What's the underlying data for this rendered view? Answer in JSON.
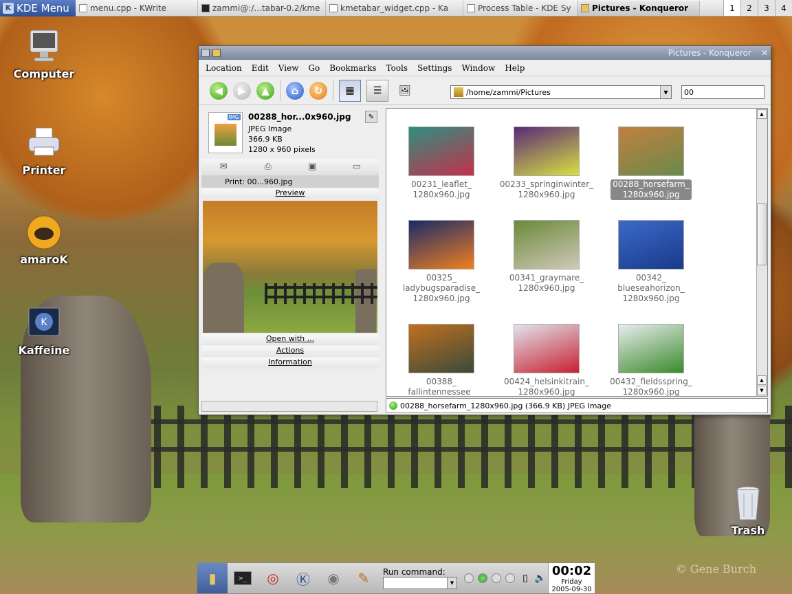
{
  "taskbar": {
    "kmenu_label": "KDE Menu",
    "tasks": [
      {
        "label": "menu.cpp - KWrite",
        "active": false
      },
      {
        "label": "zammi@:/...tabar-0.2/kme",
        "active": false
      },
      {
        "label": "kmetabar_widget.cpp - Ka",
        "active": false
      },
      {
        "label": "Process Table - KDE Sy",
        "active": false
      },
      {
        "label": "Pictures - Konqueror",
        "active": true
      }
    ],
    "desktops": [
      "1",
      "2",
      "3",
      "4"
    ],
    "current_desktop": "1"
  },
  "desktop": {
    "icons": [
      {
        "label": "Computer",
        "icon": "computer-icon"
      },
      {
        "label": "Printer",
        "icon": "printer-icon"
      },
      {
        "label": "amaroK",
        "icon": "amarok-icon"
      },
      {
        "label": "Kaffeine",
        "icon": "kaffeine-icon"
      },
      {
        "label": "Trash",
        "icon": "trash-icon"
      }
    ],
    "watermark": "© Gene Burch"
  },
  "window": {
    "title": "Pictures - Konqueror",
    "menu": [
      "Location",
      "Edit",
      "View",
      "Go",
      "Bookmarks",
      "Tools",
      "Settings",
      "Window",
      "Help"
    ],
    "location": "/home/zammi/Pictures",
    "search_value": "00"
  },
  "sidebar": {
    "file_name": "00288_hor...0x960.jpg",
    "file_type": "JPEG Image",
    "file_size": "366.9 KB",
    "file_dims": "1280 x 960 pixels",
    "badge": "IMG",
    "print_label": "Print: 00...960.jpg",
    "preview_label": "Preview",
    "open_with": "Open with ...",
    "actions": "Actions",
    "information": "Information"
  },
  "files": [
    {
      "caption": "00231_leaflet_\n1280x960.jpg",
      "selected": false,
      "colors": [
        "#2f8f80",
        "#c4304a"
      ]
    },
    {
      "caption": "00233_springinwinter_\n1280x960.jpg",
      "selected": false,
      "colors": [
        "#5a2a7a",
        "#d8e040"
      ]
    },
    {
      "caption": "00288_horsefarm_\n1280x960.jpg",
      "selected": true,
      "colors": [
        "#c08040",
        "#6a8a4a"
      ]
    },
    {
      "caption": "00325_\nladybugsparadise_\n1280x960.jpg",
      "selected": false,
      "colors": [
        "#1a2a6a",
        "#f08020"
      ]
    },
    {
      "caption": "00341_graymare_\n1280x960.jpg",
      "selected": false,
      "colors": [
        "#6a8a3a",
        "#d0c8b8"
      ]
    },
    {
      "caption": "00342_\nblueseahorizon_\n1280x960.jpg",
      "selected": false,
      "colors": [
        "#3a6ac8",
        "#1a3a8a"
      ]
    },
    {
      "caption": "00388_\nfallintennessee_",
      "selected": false,
      "colors": [
        "#c07020",
        "#3a4a3a"
      ]
    },
    {
      "caption": "00424_helsinkitrain_\n1280x960.jpg",
      "selected": false,
      "colors": [
        "#e0e4ec",
        "#c82030"
      ]
    },
    {
      "caption": "00432_fieldsspring_\n1280x960.jpg",
      "selected": false,
      "colors": [
        "#e8ecee",
        "#3a8a2a"
      ]
    }
  ],
  "statusbar": {
    "text": "00288_horsefarm_1280x960.jpg (366.9 KB)  JPEG Image"
  },
  "panel": {
    "run_label": "Run command:",
    "clock_time": "00:02",
    "clock_day": "Friday",
    "clock_date": "2005-09-30"
  }
}
